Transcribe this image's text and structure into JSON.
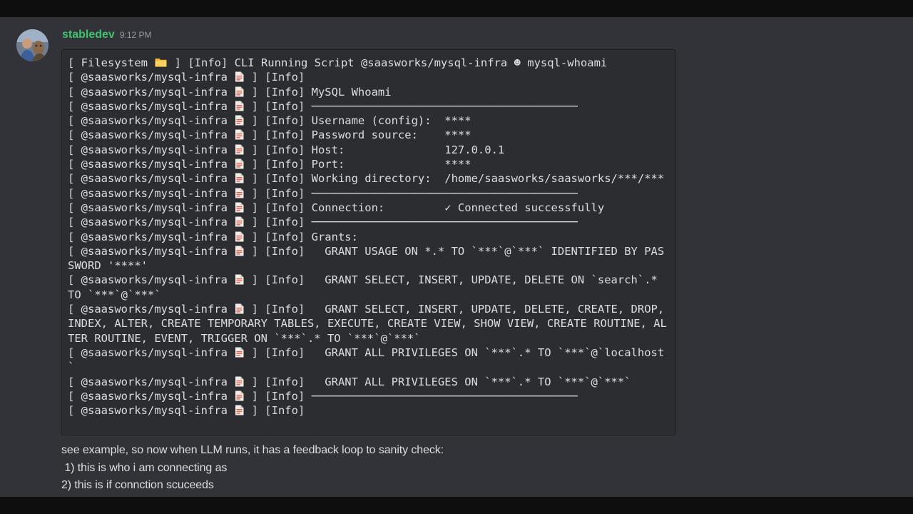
{
  "message": {
    "author": "stabledev",
    "timestamp": "9:12 PM",
    "colors": {
      "author": "#3fc26c",
      "background": "#313338",
      "codeblock_background": "#2b2d31",
      "text": "#dbdee1",
      "timestamp": "#949ba4"
    },
    "codeblock": {
      "lines": [
        [
          {
            "t": "[ Filesystem "
          },
          {
            "icon": "folder-icon"
          },
          {
            "t": " ] [Info] CLI Running Script @saasworks/mysql-infra ☻ mysql-whoami"
          }
        ],
        [
          {
            "t": "[ @saasworks/mysql-infra "
          },
          {
            "icon": "file-icon"
          },
          {
            "t": " ] [Info]"
          }
        ],
        [
          {
            "t": "[ @saasworks/mysql-infra "
          },
          {
            "icon": "file-icon"
          },
          {
            "t": " ] [Info] MySQL Whoami"
          }
        ],
        [
          {
            "t": "[ @saasworks/mysql-infra "
          },
          {
            "icon": "file-icon"
          },
          {
            "t": " ] [Info] ────────────────────────────────────────"
          }
        ],
        [
          {
            "t": "[ @saasworks/mysql-infra "
          },
          {
            "icon": "file-icon"
          },
          {
            "t": " ] [Info] Username (config):  ****"
          }
        ],
        [
          {
            "t": "[ @saasworks/mysql-infra "
          },
          {
            "icon": "file-icon"
          },
          {
            "t": " ] [Info] Password source:    ****"
          }
        ],
        [
          {
            "t": "[ @saasworks/mysql-infra "
          },
          {
            "icon": "file-icon"
          },
          {
            "t": " ] [Info] Host:               127.0.0.1"
          }
        ],
        [
          {
            "t": "[ @saasworks/mysql-infra "
          },
          {
            "icon": "file-icon"
          },
          {
            "t": " ] [Info] Port:               ****"
          }
        ],
        [
          {
            "t": "[ @saasworks/mysql-infra "
          },
          {
            "icon": "file-icon"
          },
          {
            "t": " ] [Info] Working directory:  /home/saasworks/saasworks/***/***"
          }
        ],
        [
          {
            "t": "[ @saasworks/mysql-infra "
          },
          {
            "icon": "file-icon"
          },
          {
            "t": " ] [Info] ────────────────────────────────────────"
          }
        ],
        [
          {
            "t": "[ @saasworks/mysql-infra "
          },
          {
            "icon": "file-icon"
          },
          {
            "t": " ] [Info] Connection:         ✓ Connected successfully"
          }
        ],
        [
          {
            "t": "[ @saasworks/mysql-infra "
          },
          {
            "icon": "file-icon"
          },
          {
            "t": " ] [Info] ────────────────────────────────────────"
          }
        ],
        [
          {
            "t": "[ @saasworks/mysql-infra "
          },
          {
            "icon": "file-icon"
          },
          {
            "t": " ] [Info] Grants:"
          }
        ],
        [
          {
            "t": "[ @saasworks/mysql-infra "
          },
          {
            "icon": "file-icon"
          },
          {
            "t": " ] [Info]   GRANT USAGE ON *.* TO `***`@`***` IDENTIFIED BY PASSWORD '****'"
          }
        ],
        [
          {
            "t": "[ @saasworks/mysql-infra "
          },
          {
            "icon": "file-icon"
          },
          {
            "t": " ] [Info]   GRANT SELECT, INSERT, UPDATE, DELETE ON `search`.* TO `***`@`***`"
          }
        ],
        [
          {
            "t": "[ @saasworks/mysql-infra "
          },
          {
            "icon": "file-icon"
          },
          {
            "t": " ] [Info]   GRANT SELECT, INSERT, UPDATE, DELETE, CREATE, DROP, INDEX, ALTER, CREATE TEMPORARY TABLES, EXECUTE, CREATE VIEW, SHOW VIEW, CREATE ROUTINE, ALTER ROUTINE, EVENT, TRIGGER ON `***`.* TO `***`@`***`"
          }
        ],
        [
          {
            "t": "[ @saasworks/mysql-infra "
          },
          {
            "icon": "file-icon"
          },
          {
            "t": " ] [Info]   GRANT ALL PRIVILEGES ON `***`.* TO `***`@`localhost`"
          }
        ],
        [
          {
            "t": "[ @saasworks/mysql-infra "
          },
          {
            "icon": "file-icon"
          },
          {
            "t": " ] [Info]   GRANT ALL PRIVILEGES ON `***`.* TO `***`@`***`"
          }
        ],
        [
          {
            "t": "[ @saasworks/mysql-infra "
          },
          {
            "icon": "file-icon"
          },
          {
            "t": " ] [Info] ────────────────────────────────────────"
          }
        ],
        [
          {
            "t": "[ @saasworks/mysql-infra "
          },
          {
            "icon": "file-icon"
          },
          {
            "t": " ] [Info]"
          }
        ]
      ]
    },
    "text_lines": [
      "see example, so now when LLM runs, it has a feedback loop to sanity check:",
      " 1) this is who i am connecting as",
      "2) this is if connction scuceeds"
    ]
  }
}
